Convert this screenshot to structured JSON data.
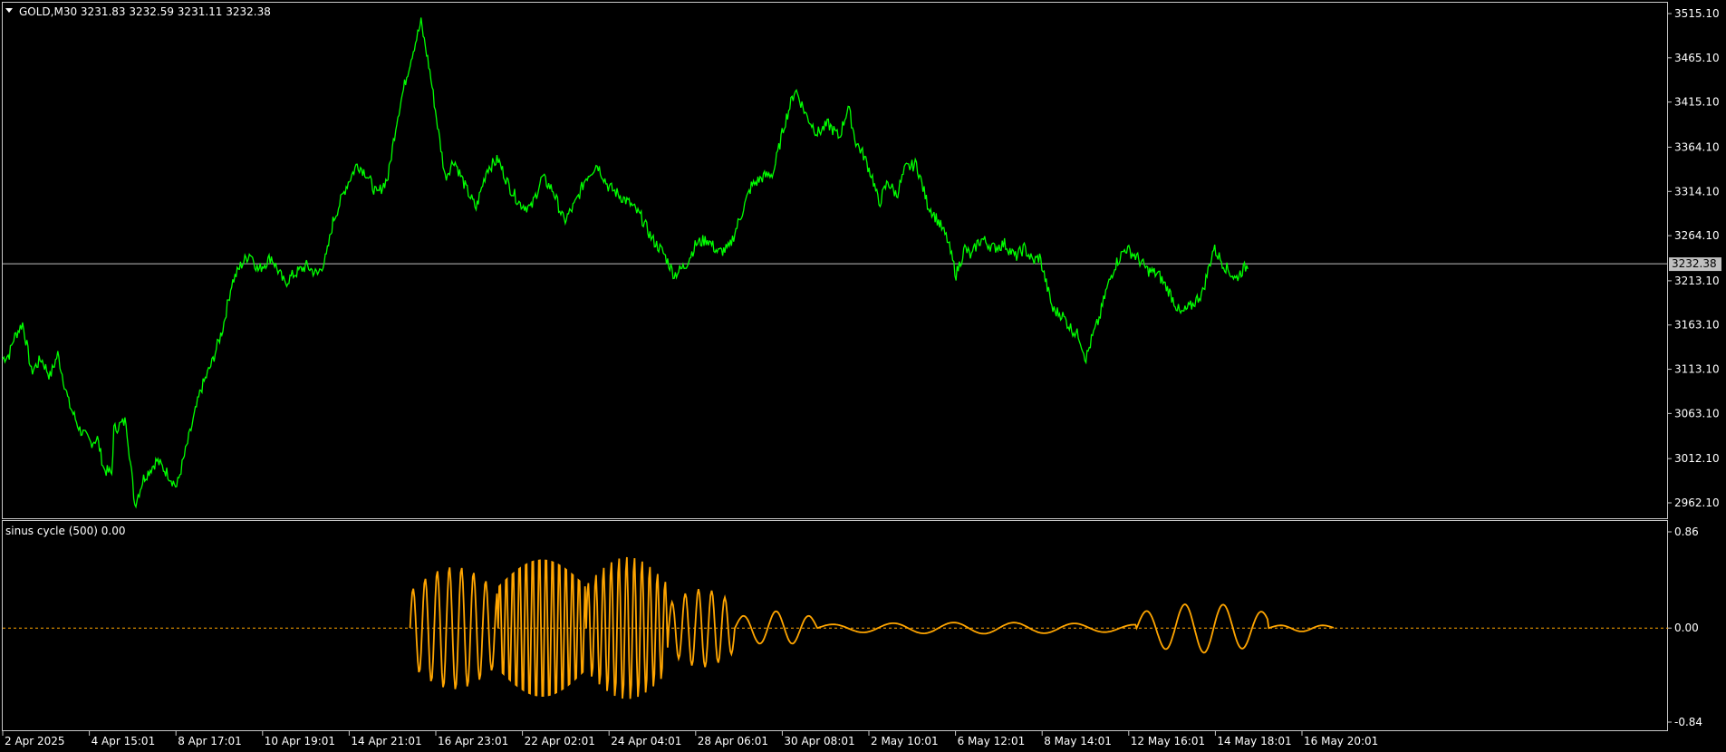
{
  "main_panel": {
    "header": "GOLD,M30  3231.83 3232.59 3231.11 3232.38",
    "price_labels": [
      "3515.10",
      "3465.10",
      "3415.10",
      "3364.10",
      "3314.10",
      "3264.10",
      "3213.10",
      "3163.10",
      "3113.10",
      "3063.10",
      "3012.10",
      "2962.10"
    ],
    "current_price": "3232.38",
    "current_price_value": 3232.38,
    "line_color": "#00ff00"
  },
  "indicator_panel": {
    "header": "sinus cycle (500) 0.00",
    "labels": [
      "0.86",
      "0.00",
      "-0.84"
    ],
    "line_color": "#ffa500"
  },
  "time_axis": [
    "2 Apr 2025",
    "4 Apr 15:01",
    "8 Apr 17:01",
    "10 Apr 19:01",
    "14 Apr 21:01",
    "16 Apr 23:01",
    "22 Apr 02:01",
    "24 Apr 04:01",
    "28 Apr 06:01",
    "30 Apr 08:01",
    "2 May 10:01",
    "6 May 12:01",
    "8 May 14:01",
    "12 May 16:01",
    "14 May 18:01",
    "16 May 20:01"
  ],
  "chart_data": [
    {
      "type": "line",
      "series": [
        {
          "name": "GOLD,M30",
          "x_index": [
            0,
            6,
            10,
            18,
            22,
            26,
            35,
            43,
            50,
            60,
            70,
            80,
            86,
            92,
            99,
            101,
            112,
            120,
            128,
            140,
            150,
            158,
            166,
            172,
            180,
            190,
            200,
            208,
            216,
            225,
            232,
            244,
            250,
            256,
            264,
            276,
            286,
            294,
            300,
            312,
            322,
            330,
            340,
            350,
            358,
            366,
            372,
            380,
            388,
            396,
            402,
            410,
            420,
            430,
            440,
            450,
            460,
            470,
            480,
            490,
            500,
            510,
            520,
            530,
            540,
            550,
            560,
            570,
            580,
            590,
            600,
            606,
            610,
            620,
            630,
            640,
            650,
            660,
            670,
            680,
            690,
            700,
            710,
            720,
            730,
            740,
            750,
            760,
            768,
            775,
            782,
            790,
            796,
            804,
            812,
            820,
            830,
            840,
            850,
            858,
            866,
            874,
            880,
            885,
            890,
            900,
            910,
            920,
            928,
            936,
            942,
            948,
            954,
            962,
            970,
            978,
            984,
            990,
            996,
            1002,
            1010,
            1020,
            1030,
            1040,
            1050,
            1060,
            1070,
            1080,
            1090,
            1100,
            1110,
            1120,
            1126,
            1132,
            1140,
            1148,
            1156,
            1164,
            1170,
            1176,
            1182,
            1188,
            1196,
            1204,
            1210
          ],
          "values": [
            3125,
            3130,
            3148,
            3165,
            3140,
            3110,
            3125,
            3105,
            3130,
            3075,
            3045,
            3030,
            3035,
            3000,
            2995,
            3045,
            3055,
            2960,
            2990,
            3010,
            2995,
            2980,
            3020,
            3050,
            3090,
            3120,
            3160,
            3210,
            3230,
            3245,
            3225,
            3240,
            3225,
            3210,
            3220,
            3230,
            3220,
            3240,
            3280,
            3320,
            3345,
            3335,
            3310,
            3330,
            3395,
            3440,
            3470,
            3505,
            3450,
            3380,
            3330,
            3350,
            3320,
            3295,
            3340,
            3350,
            3320,
            3300,
            3295,
            3330,
            3315,
            3280,
            3300,
            3330,
            3345,
            3320,
            3310,
            3300,
            3285,
            3260,
            3245,
            3230,
            3220,
            3230,
            3255,
            3260,
            3245,
            3250,
            3285,
            3320,
            3330,
            3335,
            3390,
            3430,
            3400,
            3380,
            3390,
            3375,
            3410,
            3370,
            3355,
            3330,
            3300,
            3325,
            3310,
            3340,
            3345,
            3300,
            3280,
            3260,
            3220,
            3250,
            3240,
            3255,
            3260,
            3250,
            3255,
            3240,
            3250,
            3235,
            3240,
            3210,
            3180,
            3175,
            3160,
            3150,
            3125,
            3150,
            3170,
            3200,
            3230,
            3250,
            3240,
            3225,
            3220,
            3200,
            3175,
            3185,
            3200,
            3250,
            3230,
            3215,
            3225,
            3232
          ]
        }
      ],
      "ylim": [
        2962.1,
        3515.1
      ],
      "y_ticks": [
        3515.1,
        3465.1,
        3415.1,
        3364.1,
        3314.1,
        3264.1,
        3213.1,
        3163.1,
        3113.1,
        3063.1,
        3012.1,
        2962.1
      ],
      "current_line": 3232.38,
      "grid": false
    },
    {
      "type": "line",
      "series": [
        {
          "name": "sinus cycle (500)",
          "segments": [
            {
              "x_start": 370,
              "x_end": 450,
              "period": 11,
              "amp": 0.55
            },
            {
              "x_start": 450,
              "x_end": 530,
              "period": 6,
              "amp": 0.7
            },
            {
              "x_start": 530,
              "x_end": 605,
              "period": 7,
              "amp": 0.65
            },
            {
              "x_start": 605,
              "x_end": 665,
              "period": 12,
              "amp": 0.35
            },
            {
              "x_start": 665,
              "x_end": 740,
              "period": 30,
              "amp": 0.15
            },
            {
              "x_start": 740,
              "x_end": 1030,
              "period": 55,
              "amp": 0.05
            },
            {
              "x_start": 1030,
              "x_end": 1150,
              "period": 35,
              "amp": 0.22
            },
            {
              "x_start": 1150,
              "x_end": 1210,
              "period": 40,
              "amp": 0.03
            }
          ]
        }
      ],
      "ylim": [
        -0.84,
        0.86
      ],
      "y_ticks": [
        0.86,
        0.0,
        -0.84
      ],
      "zero_line": 0.0,
      "grid": false
    }
  ]
}
